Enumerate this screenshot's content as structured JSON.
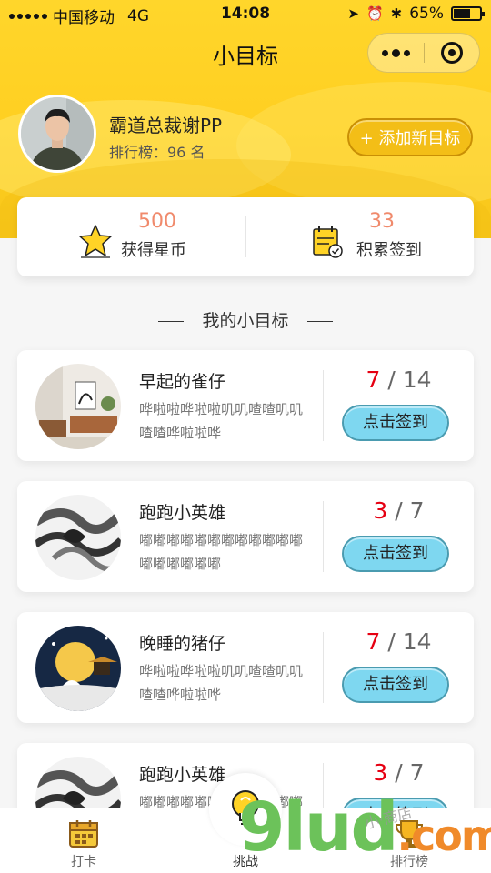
{
  "status_bar": {
    "carrier": "中国移动",
    "network": "4G",
    "time": "14:08",
    "battery": "65%",
    "battery_level": 0.65
  },
  "nav": {
    "title": "小目标"
  },
  "profile": {
    "username": "霸道总裁谢PP",
    "rank_text": "排行榜：96 名",
    "add_button": "+ 添加新目标"
  },
  "stats": [
    {
      "value": "500",
      "label": "获得星币",
      "icon": "star-icon"
    },
    {
      "value": "33",
      "label": "积累签到",
      "icon": "calendar-check-icon"
    }
  ],
  "section_title": "我的小目标",
  "goals": [
    {
      "name": "早起的雀仔",
      "desc": "哗啦啦哗啦啦叽叽喳喳叽叽喳喳哗啦啦哗",
      "done": "7",
      "total": "14",
      "button": "点击签到",
      "thumb": "room"
    },
    {
      "name": "跑跑小英雄",
      "desc": "嘟嘟嘟嘟嘟嘟嘟嘟嘟嘟嘟嘟嘟嘟嘟嘟嘟嘟",
      "done": "3",
      "total": "7",
      "button": "点击签到",
      "thumb": "ink"
    },
    {
      "name": "晚睡的猪仔",
      "desc": "哗啦啦哗啦啦叽叽喳喳叽叽喳喳哗啦啦哗",
      "done": "7",
      "total": "14",
      "button": "点击签到",
      "thumb": "moon"
    },
    {
      "name": "跑跑小英雄",
      "desc": "嘟嘟嘟嘟嘟嘟嘟嘟嘟嘟嘟嘟嘟嘟嘟嘟嘟嘟",
      "done": "3",
      "total": "7",
      "button": "点击签到",
      "thumb": "ink"
    }
  ],
  "tabbar": [
    {
      "label": "打卡",
      "icon": "calendar-icon"
    },
    {
      "label": "挑战",
      "icon": "lightbulb-icon"
    },
    {
      "label": "排行榜",
      "icon": "trophy-icon"
    }
  ],
  "watermark": {
    "brand": "9lud",
    "suffix": ".com",
    "chinese": "小·商店"
  },
  "colors": {
    "header_yellow": "#ffd62b",
    "accent_orange": "#f08a6c",
    "progress_red": "#e60012",
    "button_blue": "#7ed7f0"
  }
}
